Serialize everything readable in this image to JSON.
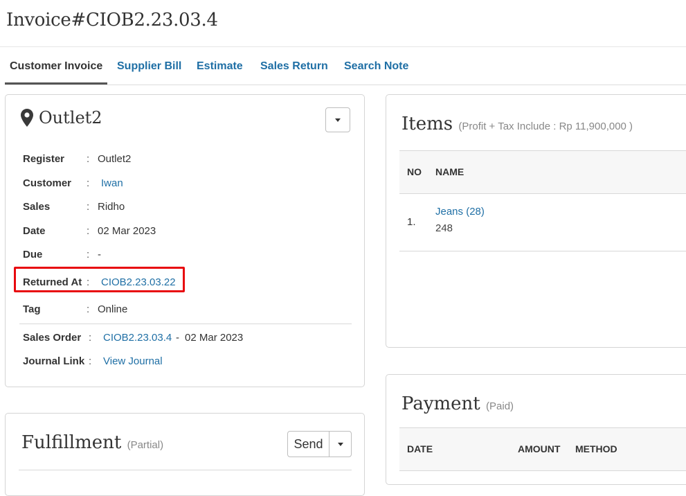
{
  "header": {
    "title": "Invoice#CIOB2.23.03.4"
  },
  "tabs": [
    {
      "label": "Customer Invoice",
      "active": true
    },
    {
      "label": "Supplier Bill",
      "active": false
    },
    {
      "label": "Estimate",
      "active": false
    },
    {
      "label": "Sales Return",
      "active": false
    },
    {
      "label": "Search Note",
      "active": false
    }
  ],
  "outlet": {
    "title": "Outlet2",
    "icon": "map-marker-icon",
    "separator": ":",
    "fields": {
      "register": {
        "label": "Register",
        "value": "Outlet2"
      },
      "customer": {
        "label": "Customer",
        "value": "Iwan"
      },
      "sales": {
        "label": "Sales",
        "value": "Ridho"
      },
      "date": {
        "label": "Date",
        "value": "02 Mar 2023"
      },
      "due": {
        "label": "Due",
        "value": "-"
      },
      "returned_at": {
        "label": "Returned At",
        "value": "CIOB2.23.03.22"
      },
      "tag": {
        "label": "Tag",
        "value": "Online"
      },
      "sales_order": {
        "label": "Sales Order",
        "value": "CIOB2.23.03.4",
        "dash": "-",
        "date": "02 Mar 2023"
      },
      "journal_link": {
        "label": "Journal Link",
        "value": "View Journal"
      }
    }
  },
  "items": {
    "title": "Items",
    "subtitle": "(Profit + Tax Include : Rp 11,900,000 )",
    "columns": {
      "no": "NO",
      "name": "NAME"
    },
    "rows": [
      {
        "no": "1.",
        "name": "Jeans (28)",
        "code": "248"
      }
    ]
  },
  "payment": {
    "title": "Payment",
    "subtitle": "(Paid)",
    "columns": {
      "date": "DATE",
      "amount": "AMOUNT",
      "method": "METHOD"
    }
  },
  "fulfillment": {
    "title": "Fulfillment",
    "subtitle": "(Partial)",
    "send_label": "Send"
  },
  "colors": {
    "link": "#1f6fa5",
    "highlight": "#e8080e",
    "text": "#333333"
  }
}
